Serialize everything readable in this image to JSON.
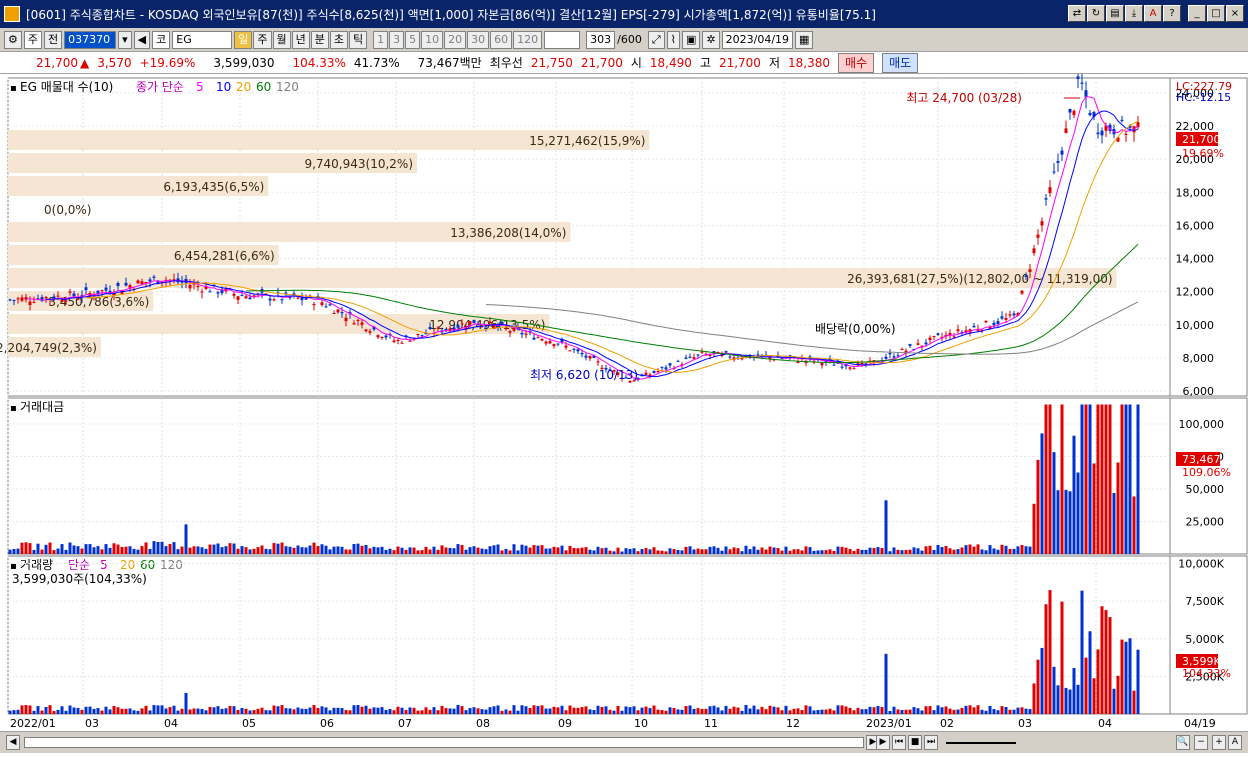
{
  "window": {
    "title": "[0601] 주식종합차트 - KOSDAQ 외국인보유[87(천)] 주식수[8,625(천)] 액면[1,000] 자본금[86(억)] 결산[12월] EPS[-279] 시가총액[1,872(억)] 유통비율[75.1]"
  },
  "toolbar": {
    "mode_label": "주",
    "prev_label": "전",
    "code_value": "037370",
    "market_label": "코",
    "name_value": "EG",
    "period_tabs": [
      "일",
      "주",
      "월",
      "년",
      "분",
      "초",
      "틱"
    ],
    "interval_buttons": [
      "1",
      "3",
      "5",
      "10",
      "20",
      "30",
      "60",
      "120"
    ],
    "count_value": "303",
    "count_total": "/600",
    "date_value": "2023/04/19"
  },
  "quote": {
    "price": "21,700",
    "change": "3,570",
    "change_pct": "+19.69%",
    "volume": "3,599,030",
    "vol_ratio": "104.33%",
    "turnover": "41.73%",
    "amount": "73,467백만",
    "best_ask_label": "최우선",
    "best_ask": "21,750",
    "best_bid": "21,700",
    "open_label": "시",
    "open": "18,490",
    "high_label": "고",
    "high": "21,700",
    "low_label": "저",
    "low": "18,380",
    "buy_label": "매수",
    "sell_label": "매도"
  },
  "price_panel": {
    "legend_title": "EG 매물대 수(10)",
    "ma_label": "종가 단순",
    "ma_periods": [
      "5",
      "10",
      "20",
      "60",
      "120"
    ],
    "ma_colors": [
      "#ff00ff",
      "#0000ff",
      "#f0a000",
      "#008000",
      "#808080"
    ],
    "lc_label": "LC:227.79",
    "hc_label": "HC:-12.15",
    "current_tag": "21,700",
    "current_pct": "19.69%",
    "high_annotation": "최고 24,700 (03/28)",
    "low_annotation": "최저 6,620 (10/13)",
    "dividend_annotation": "배당락(0,00%)",
    "y_ticks": [
      "24,000",
      "22,000",
      "20,000",
      "18,000",
      "16,000",
      "14,000",
      "12,000",
      "10,000",
      "8,000",
      "6,000"
    ],
    "volume_profile": [
      {
        "label": "15,271,462(15,9%)",
        "fraction": 0.552
      },
      {
        "label": "9,740,943(10,2%)",
        "fraction": 0.352
      },
      {
        "label": "6,193,435(6,5%)",
        "fraction": 0.224
      },
      {
        "label": "0(0,0%)",
        "fraction": 0.0
      },
      {
        "label": "13,386,208(14,0%)",
        "fraction": 0.484
      },
      {
        "label": "6,454,281(6,6%)",
        "fraction": 0.233
      },
      {
        "label": "26,393,681(27,5%)(12,802,00 ~ 11,319,00)",
        "fraction": 0.954
      },
      {
        "label": "3,450,786(3,6%)",
        "fraction": 0.125
      },
      {
        "label": "12,904,496(13,5%)",
        "fraction": 0.466
      },
      {
        "label": "2,204,749(2,3%)",
        "fraction": 0.08
      }
    ]
  },
  "amount_panel": {
    "legend_title": "거래대금",
    "y_ticks": [
      "100,000",
      "75,000",
      "50,000",
      "25,000"
    ],
    "current_tag": "73,467",
    "current_pct": "109.06%"
  },
  "volume_panel": {
    "legend_title": "거래량",
    "ma_label": "단순",
    "ma_periods": [
      "5",
      "20",
      "60",
      "120"
    ],
    "summary": "3,599,030주(104,33%)",
    "y_ticks": [
      "10,000K",
      "7,500K",
      "5,000K",
      "2,500K"
    ],
    "current_tag": "3,599K",
    "current_pct": "104.33%"
  },
  "x_axis": {
    "labels": [
      "2022/01",
      "03",
      "04",
      "05",
      "06",
      "07",
      "08",
      "09",
      "10",
      "11",
      "12",
      "2023/01",
      "02",
      "03",
      "04"
    ],
    "end_label": "04/19"
  },
  "chart_data": {
    "type": "candlestick",
    "x_range": [
      "2022/01",
      "2023/04/19"
    ],
    "y_range": [
      6000,
      24700
    ],
    "key_points": [
      {
        "x": "2022/01",
        "y": 11500
      },
      {
        "x": "2022/03",
        "y": 11800
      },
      {
        "x": "2022/04",
        "y": 12800
      },
      {
        "x": "2022/05",
        "y": 11800
      },
      {
        "x": "2022/06",
        "y": 11500
      },
      {
        "x": "2022/07",
        "y": 9000
      },
      {
        "x": "2022/08",
        "y": 10200
      },
      {
        "x": "2022/09",
        "y": 9000
      },
      {
        "x": "2022/10",
        "y": 6620
      },
      {
        "x": "2022/11",
        "y": 8200
      },
      {
        "x": "2022/12",
        "y": 8000
      },
      {
        "x": "2023/01",
        "y": 7500
      },
      {
        "x": "2023/02",
        "y": 9200
      },
      {
        "x": "2023/03",
        "y": 10500
      },
      {
        "x": "2023/03/28",
        "y": 24700
      },
      {
        "x": "2023/04",
        "y": 22000
      },
      {
        "x": "2023/04/19",
        "y": 21700
      }
    ]
  }
}
